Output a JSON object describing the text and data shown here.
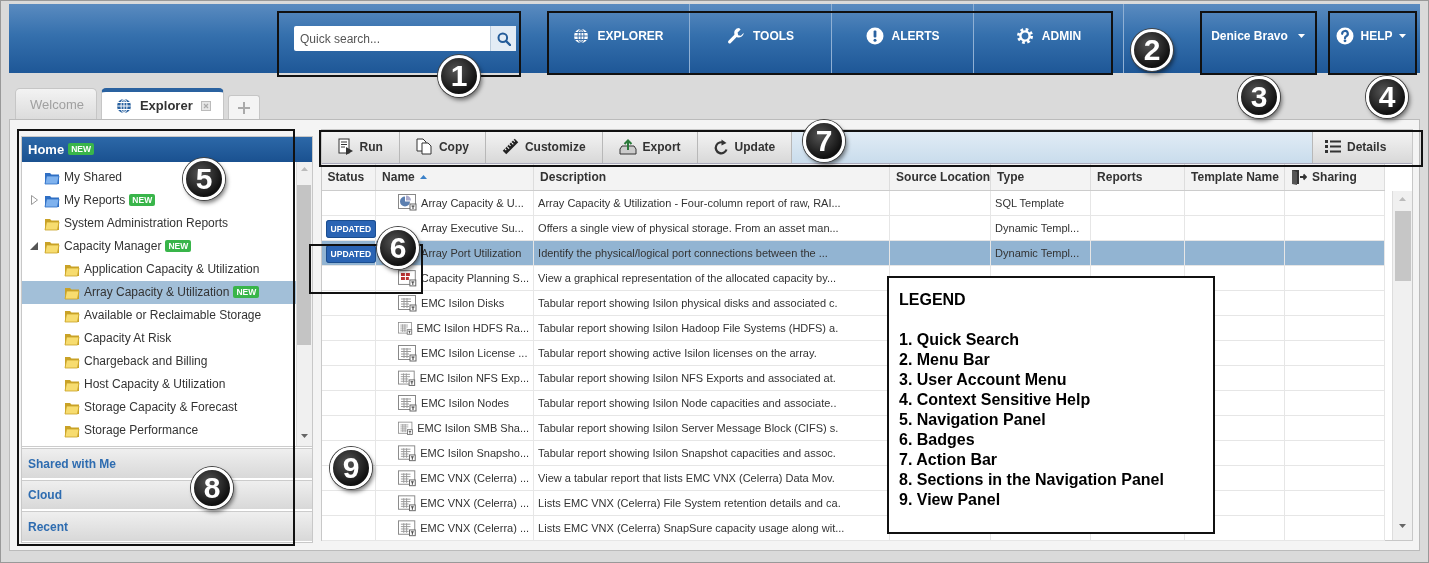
{
  "header": {
    "search": {
      "placeholder": "Quick search..."
    },
    "menu": [
      {
        "label": "EXPLORER"
      },
      {
        "label": "TOOLS"
      },
      {
        "label": "ALERTS"
      },
      {
        "label": "ADMIN"
      }
    ],
    "user_menu": {
      "label": "Denice Bravo"
    },
    "help_menu": {
      "label": "HELP"
    }
  },
  "tabs": [
    {
      "label": "Welcome",
      "selected": false,
      "closable": false
    },
    {
      "label": "Explorer",
      "selected": true,
      "closable": true
    }
  ],
  "navigation": {
    "title": "Home",
    "badge": "NEW",
    "tree": [
      {
        "label": "My Shared",
        "kind": "shared",
        "selected": false
      },
      {
        "label": "My Reports",
        "kind": "shared",
        "expanded": false,
        "badge": "NEW",
        "selected": false
      },
      {
        "label": "System Administration Reports",
        "kind": "folder",
        "selected": false
      },
      {
        "label": "Capacity Manager",
        "kind": "folder",
        "expanded": true,
        "badge": "NEW",
        "selected": false,
        "children": [
          {
            "label": "Application Capacity & Utilization",
            "kind": "folder",
            "selected": false
          },
          {
            "label": "Array Capacity & Utilization",
            "kind": "folder",
            "badge": "NEW",
            "selected": true
          },
          {
            "label": "Available or Reclaimable Storage",
            "kind": "folder",
            "selected": false
          },
          {
            "label": "Capacity At Risk",
            "kind": "folder",
            "selected": false
          },
          {
            "label": "Chargeback and Billing",
            "kind": "folder",
            "selected": false
          },
          {
            "label": "Host Capacity & Utilization",
            "kind": "folder",
            "selected": false
          },
          {
            "label": "Storage Capacity & Forecast",
            "kind": "folder",
            "selected": false
          },
          {
            "label": "Storage Performance",
            "kind": "folder",
            "selected": false
          }
        ]
      }
    ],
    "sections": [
      {
        "label": "Shared with Me"
      },
      {
        "label": "Cloud"
      },
      {
        "label": "Recent"
      }
    ]
  },
  "action_bar": {
    "actions": [
      {
        "label": "Run"
      },
      {
        "label": "Copy"
      },
      {
        "label": "Customize"
      },
      {
        "label": "Export"
      },
      {
        "label": "Update"
      }
    ],
    "details": {
      "label": "Details"
    }
  },
  "table": {
    "columns": [
      {
        "label": "Status",
        "sorted": false
      },
      {
        "label": "Name",
        "sorted": true
      },
      {
        "label": "Description",
        "sorted": false
      },
      {
        "label": "Source Location",
        "sorted": false
      },
      {
        "label": "Type",
        "sorted": false
      },
      {
        "label": "Reports",
        "sorted": false
      },
      {
        "label": "Template Name",
        "sorted": false
      },
      {
        "label": "Sharing",
        "sorted": false
      }
    ],
    "rows": [
      {
        "kind": "pie",
        "name": "Array Capacity & U...",
        "description": "Array Capacity & Utilization - Four-column report of raw, RAI...",
        "type": "SQL Template",
        "selected": false
      },
      {
        "status": "UPDATED",
        "name": "Array Executive Su...",
        "description": "Offers a single view of physical storage. From an asset man...",
        "type": "Dynamic Templ...",
        "selected": false
      },
      {
        "status": "UPDATED",
        "name": "Array Port Utilization",
        "description": "Identify the physical/logical port connections between the ...",
        "type": "Dynamic Templ...",
        "selected": true
      },
      {
        "kind": "grid",
        "name": "Capacity Planning S...",
        "description": "View a graphical representation of the allocated capacity by...",
        "selected": false
      },
      {
        "kind": "table",
        "name": "EMC Isilon Disks",
        "description": "Tabular report showing Isilon physical disks and associated c.",
        "selected": false
      },
      {
        "kind": "table",
        "name": "EMC Isilon HDFS Ra...",
        "description": "Tabular report showing Isilon Hadoop File Systems (HDFS) a.",
        "selected": false
      },
      {
        "kind": "table",
        "name": "EMC Isilon License ...",
        "description": "Tabular report showing active Isilon licenses on the array.",
        "selected": false
      },
      {
        "kind": "table",
        "name": "EMC Isilon NFS Exp...",
        "description": "Tabular report showing Isilon NFS Exports and associated at.",
        "selected": false
      },
      {
        "kind": "table",
        "name": "EMC Isilon Nodes",
        "description": "Tabular report showing Isilon Node capacities and associate..",
        "selected": false
      },
      {
        "kind": "table",
        "name": "EMC Isilon SMB Sha...",
        "description": "Tabular report showing Isilon Server Message Block (CIFS) s.",
        "selected": false
      },
      {
        "kind": "table",
        "name": "EMC Isilon Snapsho...",
        "description": "Tabular report showing Isilon Snapshot capacities and assoc.",
        "selected": false
      },
      {
        "kind": "table",
        "name": "EMC VNX (Celerra) ...",
        "description": "View a tabular report that lists EMC VNX (Celerra) Data Mov.",
        "selected": false
      },
      {
        "kind": "table",
        "name": "EMC VNX (Celerra) ...",
        "description": "Lists EMC VNX (Celerra) File System retention details and ca.",
        "selected": false
      },
      {
        "kind": "table",
        "name": "EMC VNX (Celerra) ...",
        "description": "Lists EMC VNX (Celerra) SnapSure capacity usage along wit...",
        "selected": false
      }
    ]
  },
  "callouts": [
    "1",
    "2",
    "3",
    "4",
    "5",
    "6",
    "7",
    "8",
    "9"
  ],
  "legend": {
    "title": "LEGEND",
    "items": [
      "1. Quick Search",
      "2. Menu Bar",
      "3. User Account Menu",
      "4. Context Sensitive Help",
      "5. Navigation Panel",
      "6. Badges",
      "7. Action Bar",
      "8. Sections in the Navigation Panel",
      "9. View Panel"
    ]
  }
}
